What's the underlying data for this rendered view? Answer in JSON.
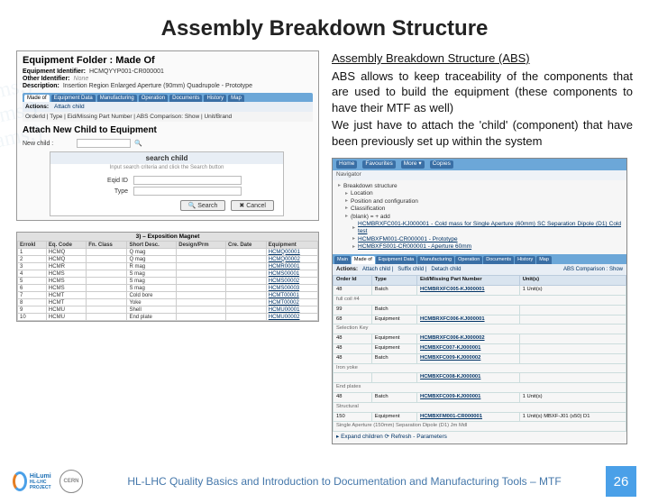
{
  "title": "Assembly Breakdown Structure",
  "right_text": {
    "subhead": "Assembly Breakdown Structure (ABS)",
    "p1": "ABS allows to keep traceability of the components that are used to build the equipment (these components to have their MTF as well)",
    "p2": "We just have to attach the 'child' (component) that have been previously set up within the system"
  },
  "eq_folder": {
    "heading": "Equipment Folder : Made Of",
    "id_label": "Equipment Identifier:",
    "id_value": "HCMQYYP001-CR000001",
    "other_label": "Other Identifier:",
    "other_value": "None",
    "desc_label": "Description:",
    "desc_value": "Insertion Region Enlarged Aperture (90mm) Quadrupole - Prototype",
    "tabs": [
      "Made of",
      "Equipment Data",
      "Manufacturing",
      "Operation",
      "Documents",
      "History",
      "Map"
    ],
    "action_hdr": "Actions:",
    "action_attach": "Attach child",
    "col_headers": "OrderId | Type | Eid/Missing Part Number | ABS Comparison: Show | Unit/Brand",
    "attach_title": "Attach New Child to Equipment",
    "newchild_label": "New child :"
  },
  "search": {
    "title": "search child",
    "note": "Input search criteria and click the Search button",
    "f1": "Eqid ID",
    "f2": "Type",
    "btn_search": "🔍 Search",
    "btn_cancel": "✖ Cancel"
  },
  "wide_table": {
    "title": "3) – Exposition Magnet",
    "headers": [
      "Errokl",
      "Eq. Code",
      "Fn. Class",
      "Short Desc.",
      "Design/Prm",
      "Cre. Date",
      "Equipment"
    ],
    "rows": [
      [
        "1",
        "HCMQ",
        "",
        "Q mag",
        "",
        "",
        "HCMQ00001"
      ],
      [
        "2",
        "HCMQ",
        "",
        "Q mag",
        "",
        "",
        "HCMQ00002"
      ],
      [
        "3",
        "HCMR",
        "",
        "R mag",
        "",
        "",
        "HCMR00001"
      ],
      [
        "4",
        "HCMS",
        "",
        "S mag",
        "",
        "",
        "HCMS00001"
      ],
      [
        "5",
        "HCMS",
        "",
        "S mag",
        "",
        "",
        "HCMS00002"
      ],
      [
        "6",
        "HCMS",
        "",
        "S mag",
        "",
        "",
        "HCMS00003"
      ],
      [
        "7",
        "HCMT",
        "",
        "Cold bore",
        "",
        "",
        "HCMT00001"
      ],
      [
        "8",
        "HCMT",
        "",
        "Yoke",
        "",
        "",
        "HCMT00002"
      ],
      [
        "9",
        "HCMU",
        "",
        "Shell",
        "",
        "",
        "HCMU00001"
      ],
      [
        "10",
        "HCMU",
        "",
        "End plate",
        "",
        "",
        "HCMU00002"
      ]
    ]
  },
  "right_shot": {
    "topnav": [
      "Home",
      "Favourites",
      "More ▾",
      "Copies"
    ],
    "nav_label": "Navigator",
    "tree": [
      {
        "t": "Breakdown structure",
        "i": 0
      },
      {
        "t": "Location",
        "i": 1
      },
      {
        "t": "Position and configuration",
        "i": 1
      },
      {
        "t": "Classification",
        "i": 1
      },
      {
        "t": "(blank) = + add",
        "i": 1
      },
      {
        "t": "HCMBRXFC001-KJ000001 - Cold mass for Single Aperture (60mm) SC Separation Dipole (D1) Cold test",
        "i": 2,
        "k": "link"
      },
      {
        "t": "HCMBXFM001-CR000001 - Prototype",
        "i": 2,
        "k": "link"
      },
      {
        "t": "HCMBXFS001-CR000001 - Aperture 60mm",
        "i": 2,
        "k": "link"
      }
    ],
    "tabs": [
      "Main",
      "Made of",
      "Equipment Data",
      "Manufacturing",
      "Operation",
      "Documents",
      "History",
      "Map"
    ],
    "actions_hdr": "Actions:",
    "actions": [
      "Attach child |",
      "Suffix child |",
      "Detach child"
    ],
    "actions_right": "ABS Comparison : Show",
    "table_headers": [
      "Order Id",
      "Type",
      "Eid/Missing Part Number",
      "Unit(s)"
    ],
    "rows": [
      {
        "o": "48",
        "t": "Batch",
        "p": "HCMBRXFC005-KJ000001",
        "d": "full coil #4",
        "u": "1 Unit(s)"
      },
      {
        "o": "99",
        "t": "Batch",
        "p": "",
        "d": "",
        "u": ""
      },
      {
        "o": "68",
        "t": "Equipment",
        "p": "HCMBRXFC006-KJ000001",
        "d": "Selection Key",
        "u": ""
      },
      {
        "o": "48",
        "t": "Equipment",
        "p": "HCMBRXFC006-KJ000002",
        "d": "",
        "u": ""
      },
      {
        "o": "48",
        "t": "Equipment",
        "p": "HCMBXFC007-KJ000001",
        "d": "",
        "u": ""
      },
      {
        "o": "48",
        "t": "Batch",
        "p": "HCMBXFC009-KJ000002",
        "d": "Iron yoke",
        "u": ""
      },
      {
        "o": "",
        "t": "",
        "p": "HCMBXFC008-KJ000001",
        "d": "End plates",
        "u": ""
      },
      {
        "o": "48",
        "t": "Batch",
        "p": "HCMBXFC009-KJ000001",
        "d": "Structural",
        "u": "1 Unit(s)"
      },
      {
        "o": "150",
        "t": "Equipment",
        "p": "HCMBXFM001-CR000001",
        "d": "Single Aperture (150mm) Separation Dipole (D1) Jm Mdl",
        "u": "1 Unit(s) MBXF-J01 (s50) D1"
      }
    ],
    "expand": "▸ Expand children  ⟳ Refresh  - Parameters"
  },
  "footer": {
    "hilumi": "HiLumi",
    "hilumi2": "HL-LHC PROJECT",
    "cern": "CERN",
    "text": "HL-LHC Quality Basics and Introduction to Documentation and Manufacturing Tools – MTF",
    "page": "26"
  },
  "watermark": "ams;) ams;) ams;)"
}
